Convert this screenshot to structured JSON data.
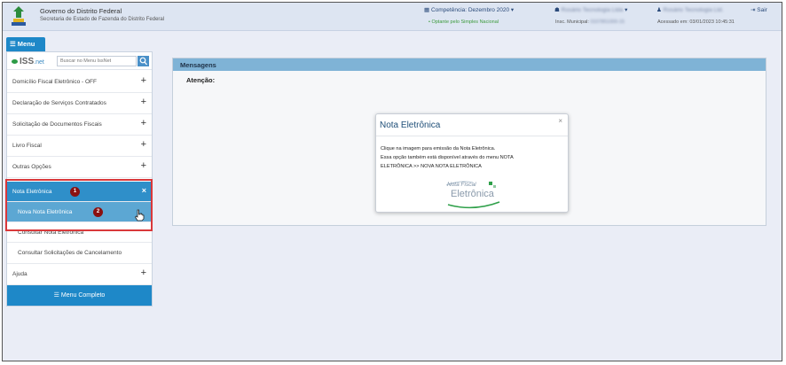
{
  "header": {
    "gov_title": "Governo do Distrito Federal",
    "gov_subtitle": "Secretaria de Estado de Fazenda do Distrito Federal",
    "competencia": "Competência: Dezembro 2020",
    "simples": "• Optante pelo Simples Nacional",
    "company1": "Rosário Tecnologia Ltda",
    "insc_municipal_label": "Insc. Municipal:",
    "insc_municipal_value": "0107851000-15",
    "company2": "Rosário Tecnologia Ltd.",
    "acessado": "Acessado em: 03/01/2023 10:45:31",
    "logout": "Sair"
  },
  "menu_tab": "☰ Menu",
  "sidebar": {
    "search_placeholder": "Buscar no Menu IssNet",
    "logo_iss": "ISS",
    "logo_net": ".net",
    "items": [
      {
        "label": "Domicílio Fiscal Eletrônico - OFF"
      },
      {
        "label": "Declaração de Serviços Contratados"
      },
      {
        "label": "Solicitação de Documentos Fiscais"
      },
      {
        "label": "Livro Fiscal"
      },
      {
        "label": "Outras Opções"
      },
      {
        "label": "Nota Eletrônica"
      },
      {
        "label": "Nova Nota Eletrônica"
      },
      {
        "label": "Consultar Nota Eletrônica"
      },
      {
        "label": "Consultar Solicitações de Cancelamento"
      },
      {
        "label": "Ajuda"
      }
    ],
    "badge1": "1",
    "badge2": "2",
    "menu_completo": "☰ Menu Completo"
  },
  "main": {
    "title": "Mensagens",
    "atencao": "Atenção:"
  },
  "modal": {
    "title": "Nota Eletrônica",
    "close": "×",
    "line1": "Clique na imagem para emissão da Nota Eletrônica.",
    "line2": "Essa opção também está disponível através do menu NOTA",
    "line3": "ELETRÔNICA >> NOVA NOTA ELETRÔNICA",
    "logo_top": "Nota Fiscal",
    "logo_bottom": "Eletrônica"
  },
  "colors": {
    "accent": "#1e88c8",
    "highlight": "#d9383a",
    "badge": "#8b1010"
  }
}
